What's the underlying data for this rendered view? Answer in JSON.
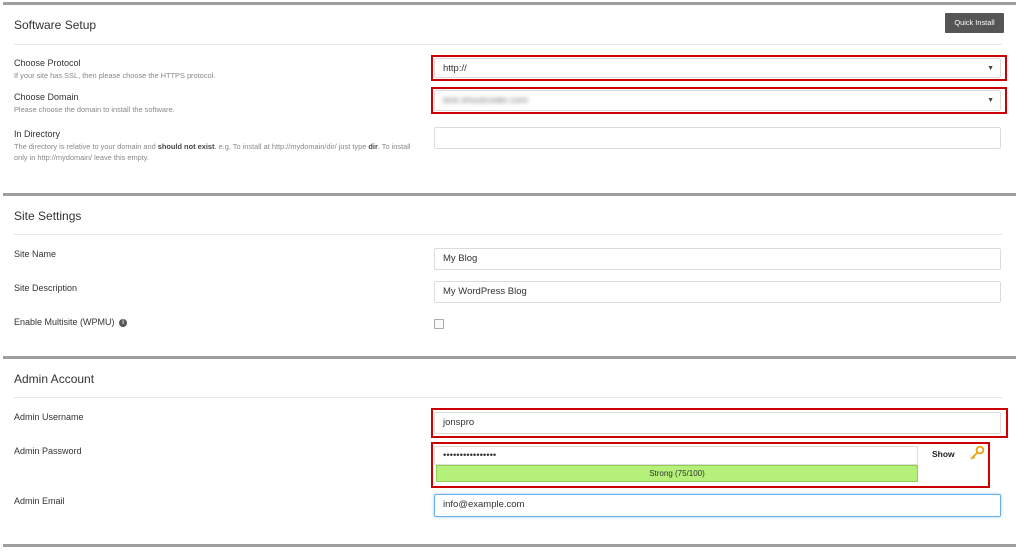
{
  "software_setup": {
    "title": "Software Setup",
    "quick_install_label": "Quick Install",
    "protocol": {
      "label": "Choose Protocol",
      "hint": "If your site has SSL, then please choose the HTTPS protocol.",
      "value": "http://"
    },
    "domain": {
      "label": "Choose Domain",
      "hint": "Please choose the domain to install the software.",
      "value": "test.shoutcoder.com"
    },
    "directory": {
      "label": "In Directory",
      "hint_part1": "The directory is relative to your domain and ",
      "hint_bold1": "should not exist",
      "hint_part2": ". e.g. To install at http://mydomain/dir/ just type ",
      "hint_bold2": "dir",
      "hint_part3": ". To install only in http://mydomain/ leave this empty.",
      "value": ""
    }
  },
  "site_settings": {
    "title": "Site Settings",
    "site_name": {
      "label": "Site Name",
      "value": "My Blog"
    },
    "site_description": {
      "label": "Site Description",
      "value": "My WordPress Blog"
    },
    "multisite": {
      "label": "Enable Multisite (WPMU)",
      "checked": false
    }
  },
  "admin_account": {
    "title": "Admin Account",
    "username": {
      "label": "Admin Username",
      "value": "jonspro"
    },
    "password": {
      "label": "Admin Password",
      "value": "••••••••••••••••",
      "strength_label": "Strong (75/100)",
      "strength_value": 75,
      "show_label": "Show"
    },
    "email": {
      "label": "Admin Email",
      "value": "info@example.com"
    }
  },
  "colors": {
    "highlight": "#cc0000",
    "strength_fill": "#b4f07a",
    "button_bg": "#555555",
    "focus_border": "#66afe9"
  },
  "icons": {
    "dropdown": "chevron-down-icon",
    "info": "info-icon",
    "key": "key-icon"
  }
}
